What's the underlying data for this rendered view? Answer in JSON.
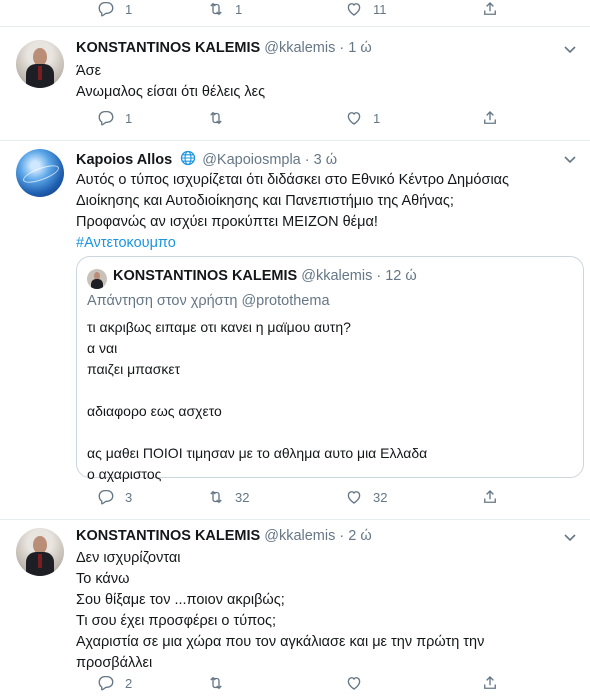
{
  "top_actions": {
    "replies": "1",
    "retweets": "1",
    "likes": "11"
  },
  "tweets": [
    {
      "name": "KONSTANTINOS KALEMIS",
      "handle": "@kkalemis",
      "time": "· 1 ώ",
      "lines": [
        "Άσε",
        "Ανωμαλος είσαι ότι θέλεις λες"
      ],
      "replies": "1",
      "retweets": "",
      "likes": "1"
    },
    {
      "name": "Kapoios Allos",
      "handle": "@Kapoiosmpla",
      "time": "· 3 ώ",
      "lines": [
        "Αυτός ο τύπος ισχυρίζεται ότι διδάσκει στο Εθνικό Κέντρο Δημόσιας",
        "Διοίκησης και Αυτοδιοίκησης και Πανεπιστήμιο της Αθήνας;",
        "Προφανώς αν ισχύει προκύπτει ΜΕΙΖΟΝ θέμα!"
      ],
      "hashtag": "#Αντετοκουμπο",
      "quote": {
        "name": "KONSTANTINOS KALEMIS",
        "handle": "@kkalemis",
        "time": "· 12 ώ",
        "reply_to": "Απάντηση στον χρήστη @protothema",
        "lines": [
          "τι ακριβως ειπαμε οτι κανει η μαϊμου αυτη?",
          "α ναι",
          "παιζει μπασκετ",
          "",
          "αδιαφορο εως ασχετο",
          "",
          "ας μαθει ΠΟΙΟΙ τιμησαν με το αθλημα αυτο μια Ελλαδα",
          "ο αχαριστος"
        ]
      },
      "replies": "3",
      "retweets": "32",
      "likes": "32"
    },
    {
      "name": "KONSTANTINOS KALEMIS",
      "handle": "@kkalemis",
      "time": "· 2 ώ",
      "lines": [
        "Δεν ισχυρίζονται",
        "Το κάνω",
        "Σου θίξαμε τον ...ποιον ακριβώς;",
        "Τι σου έχει προσφέρει ο τύπος;",
        "Αχαριστία σε μια χώρα που τον αγκάλιασε και με την πρώτη την",
        "προσβάλλει"
      ],
      "replies": "2",
      "retweets": "",
      "likes": ""
    }
  ],
  "icons": {
    "reply": "reply-icon",
    "retweet": "retweet-icon",
    "like": "heart-icon",
    "share": "share-icon",
    "more": "chevron-down-icon",
    "verified_globe": "globe-icon"
  },
  "colors": {
    "link": "#1b95e0",
    "muted": "#657786",
    "border": "#e6ecf0"
  }
}
